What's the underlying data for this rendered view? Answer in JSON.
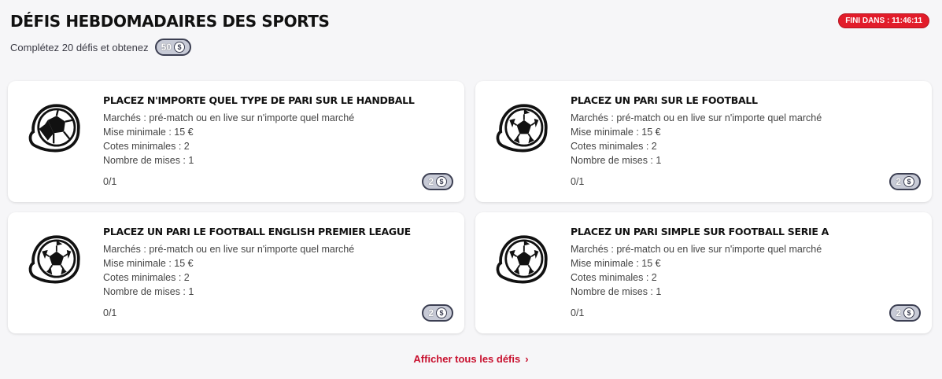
{
  "header": {
    "title": "DÉFIS HEBDOMADAIRES DES SPORTS",
    "timer": "FINI DANS : 11:46:11",
    "subtitle": "Complétez 20 défis et obtenez",
    "total_reward": "50"
  },
  "labels": {
    "markets_prefix": "Marchés : pré-match ou en live sur n'importe quel marché",
    "min_stake": "Mise minimale : 15 €",
    "min_odds": "Cotes minimales : 2",
    "num_bets": "Nombre de mises : 1"
  },
  "challenges": [
    {
      "title": "PLACEZ N'IMPORTE QUEL TYPE DE PARI SUR LE HANDBALL",
      "markets": "Marchés : pré-match ou en live sur n'importe quel marché",
      "min_stake": "Mise minimale : 15 €",
      "min_odds": "Cotes minimales : 2",
      "num_bets": "Nombre de mises : 1",
      "progress": "0/1",
      "reward": "2",
      "icon": "handball-icon"
    },
    {
      "title": "PLACEZ UN PARI SUR LE FOOTBALL",
      "markets": "Marchés : pré-match ou en live sur n'importe quel marché",
      "min_stake": "Mise minimale : 15 €",
      "min_odds": "Cotes minimales : 2",
      "num_bets": "Nombre de mises : 1",
      "progress": "0/1",
      "reward": "2",
      "icon": "football-icon"
    },
    {
      "title": "PLACEZ UN PARI LE FOOTBALL ENGLISH PREMIER LEAGUE",
      "markets": "Marchés : pré-match ou en live sur n'importe quel marché",
      "min_stake": "Mise minimale : 15 €",
      "min_odds": "Cotes minimales : 2",
      "num_bets": "Nombre de mises : 1",
      "progress": "0/1",
      "reward": "2",
      "icon": "football-icon"
    },
    {
      "title": "PLACEZ UN PARI SIMPLE SUR FOOTBALL SERIE A",
      "markets": "Marchés : pré-match ou en live sur n'importe quel marché",
      "min_stake": "Mise minimale : 15 €",
      "min_odds": "Cotes minimales : 2",
      "num_bets": "Nombre de mises : 1",
      "progress": "0/1",
      "reward": "2",
      "icon": "football-icon"
    }
  ],
  "footer": {
    "view_all": "Afficher tous les défis"
  },
  "colors": {
    "accent_red": "#e21c2a",
    "link_red": "#c8102e",
    "pill_grey": "#c7cad6"
  }
}
